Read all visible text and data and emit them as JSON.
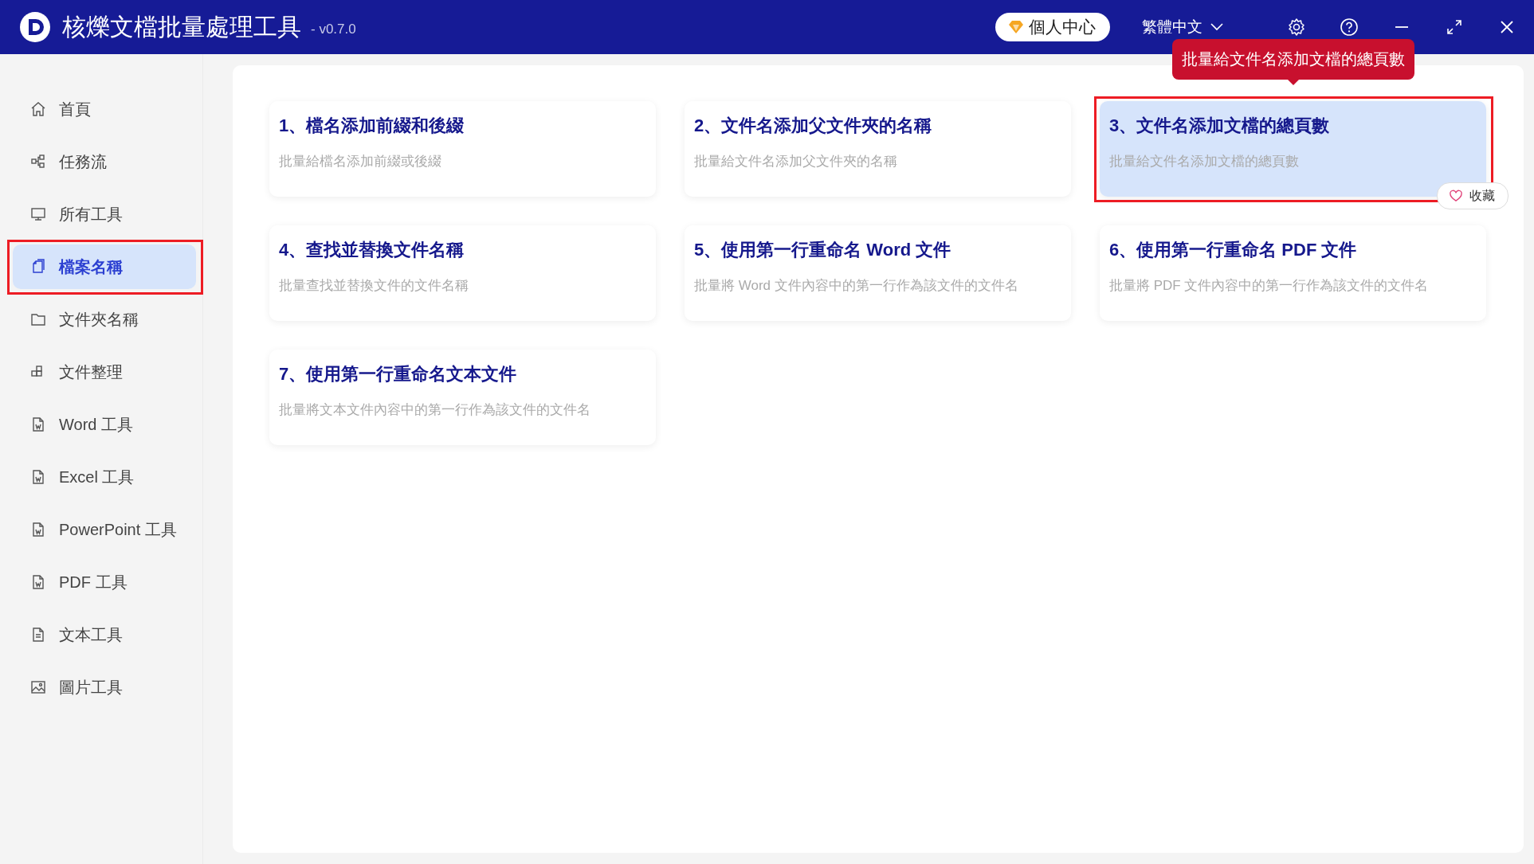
{
  "window": {
    "title": "核爍文檔批量處理工具",
    "version": "- v0.7.0",
    "account_button": "個人中心",
    "language": "繁體中文"
  },
  "sidebar": {
    "items": [
      {
        "label": "首頁",
        "kind": "home",
        "selected": false
      },
      {
        "label": "任務流",
        "kind": "flow",
        "selected": false
      },
      {
        "label": "所有工具",
        "kind": "monitor",
        "selected": false
      },
      {
        "label": "檔案名稱",
        "kind": "files",
        "selected": true
      },
      {
        "label": "文件夾名稱",
        "kind": "folder",
        "selected": false
      },
      {
        "label": "文件整理",
        "kind": "blocks",
        "selected": false
      },
      {
        "label": "Word 工具",
        "kind": "doc",
        "selected": false
      },
      {
        "label": "Excel 工具",
        "kind": "doc",
        "selected": false
      },
      {
        "label": "PowerPoint 工具",
        "kind": "doc",
        "selected": false
      },
      {
        "label": "PDF 工具",
        "kind": "doc",
        "selected": false
      },
      {
        "label": "文本工具",
        "kind": "text",
        "selected": false
      },
      {
        "label": "圖片工具",
        "kind": "image",
        "selected": false
      }
    ]
  },
  "cards": [
    {
      "title": "1、檔名添加前綴和後綴",
      "description": "批量給檔名添加前綴或後綴",
      "selected": false
    },
    {
      "title": "2、文件名添加父文件夾的名稱",
      "description": "批量給文件名添加父文件夾的名稱",
      "selected": false
    },
    {
      "title": "3、文件名添加文檔的總頁數",
      "description": "批量給文件名添加文檔的總頁數",
      "selected": true
    },
    {
      "title": "4、查找並替換文件名稱",
      "description": "批量查找並替換文件的文件名稱",
      "selected": false
    },
    {
      "title": "5、使用第一行重命名 Word 文件",
      "description": "批量將 Word 文件內容中的第一行作為該文件的文件名",
      "selected": false
    },
    {
      "title": "6、使用第一行重命名 PDF 文件",
      "description": "批量將 PDF 文件內容中的第一行作為該文件的文件名",
      "selected": false
    },
    {
      "title": "7、使用第一行重命名文本文件",
      "description": "批量將文本文件內容中的第一行作為該文件的文件名",
      "selected": false
    }
  ],
  "tooltip": "批量給文件名添加文檔的總頁數",
  "favorite_button": "收藏"
}
